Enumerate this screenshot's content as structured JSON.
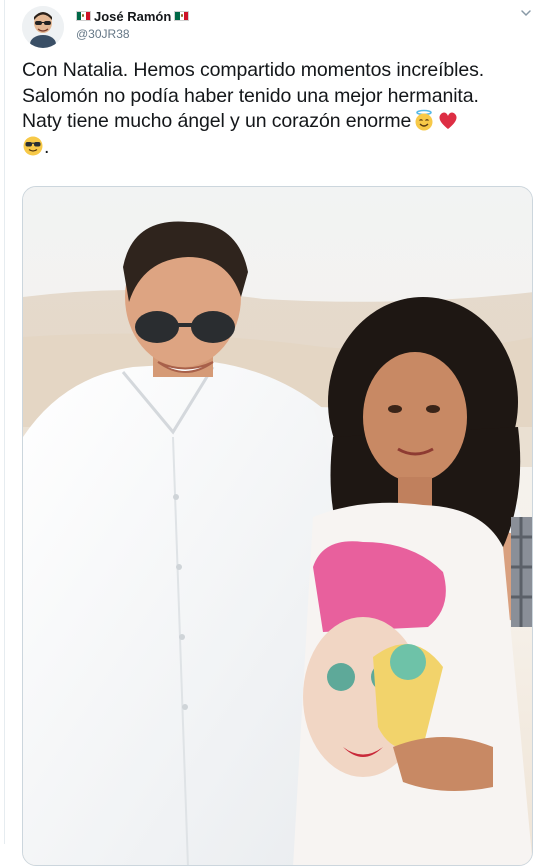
{
  "tweet": {
    "author": {
      "display_name": "José Ramón",
      "handle": "@30JR38",
      "flag_icon": "mexico-flag-icon",
      "avatar_icon": "caricature-avatar-icon"
    },
    "menu_icon": "chevron-down-icon",
    "text_lines": [
      "Con Natalia. Hemos compartido momentos increíbles.",
      "Salomón no podía haber tenido una mejor hermanita.",
      "Naty tiene mucho ángel y un corazón enorme",
      "."
    ],
    "emojis": [
      "smiling-face-with-halo-emoji",
      "red-heart-emoji",
      "smiling-face-with-sunglasses-emoji"
    ],
    "media": {
      "kind": "photo",
      "description_icon": "photo-man-and-girl"
    }
  },
  "colors": {
    "text": "#14171a",
    "secondary": "#657786",
    "border": "#ccd6dd"
  }
}
